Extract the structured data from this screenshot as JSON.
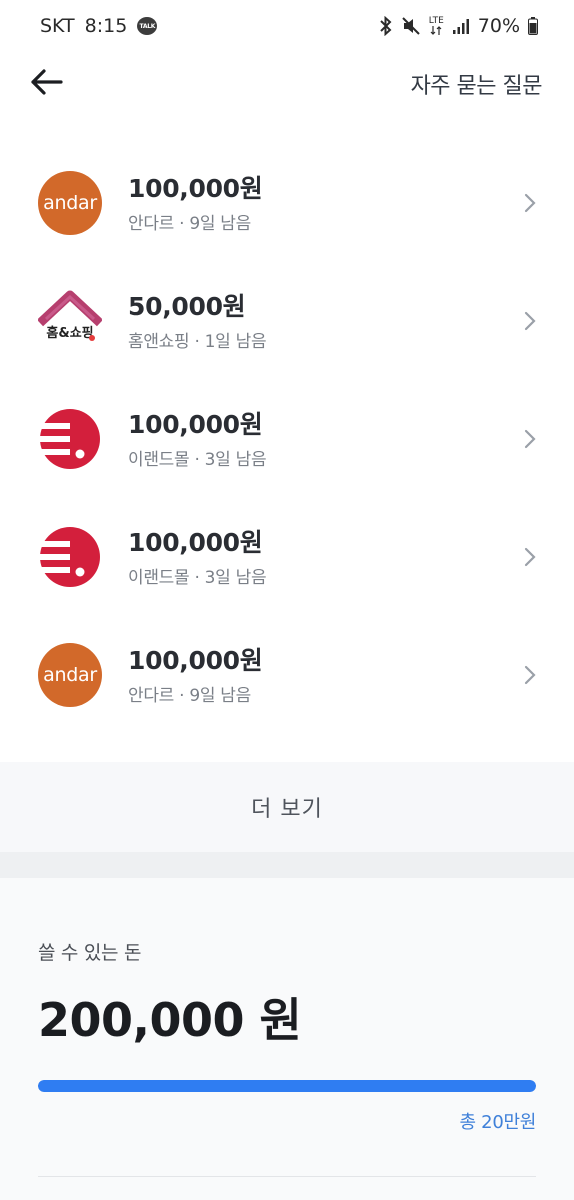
{
  "status_bar": {
    "carrier": "SKT",
    "time": "8:15",
    "talk_badge": "TALK",
    "network": "LTE",
    "battery": "70%"
  },
  "header": {
    "back_icon": "arrow-left-icon",
    "faq_label": "자주 묻는 질문"
  },
  "coupons": [
    {
      "logo": "andar",
      "logo_text": "andar",
      "amount": "100,000원",
      "detail": "안다르 · 9일 남음"
    },
    {
      "logo": "home",
      "logo_text": "홈&쇼핑",
      "amount": "50,000원",
      "detail": "홈앤쇼핑 · 1일 남음"
    },
    {
      "logo": "eland",
      "logo_text": "",
      "amount": "100,000원",
      "detail": "이랜드몰 · 3일 남음"
    },
    {
      "logo": "eland",
      "logo_text": "",
      "amount": "100,000원",
      "detail": "이랜드몰 · 3일 남음"
    },
    {
      "logo": "andar",
      "logo_text": "andar",
      "amount": "100,000원",
      "detail": "안다르 · 9일 남음"
    }
  ],
  "more_button": "더 보기",
  "balance": {
    "label": "쓸 수 있는 돈",
    "amount": "200,000 원",
    "total": "총 20만원",
    "progress_fraction": 1.0
  },
  "colors": {
    "andar": "#d2692a",
    "eland": "#d31f3c",
    "home_roof": "#b63f6e",
    "accent_blue": "#2f7df2"
  }
}
